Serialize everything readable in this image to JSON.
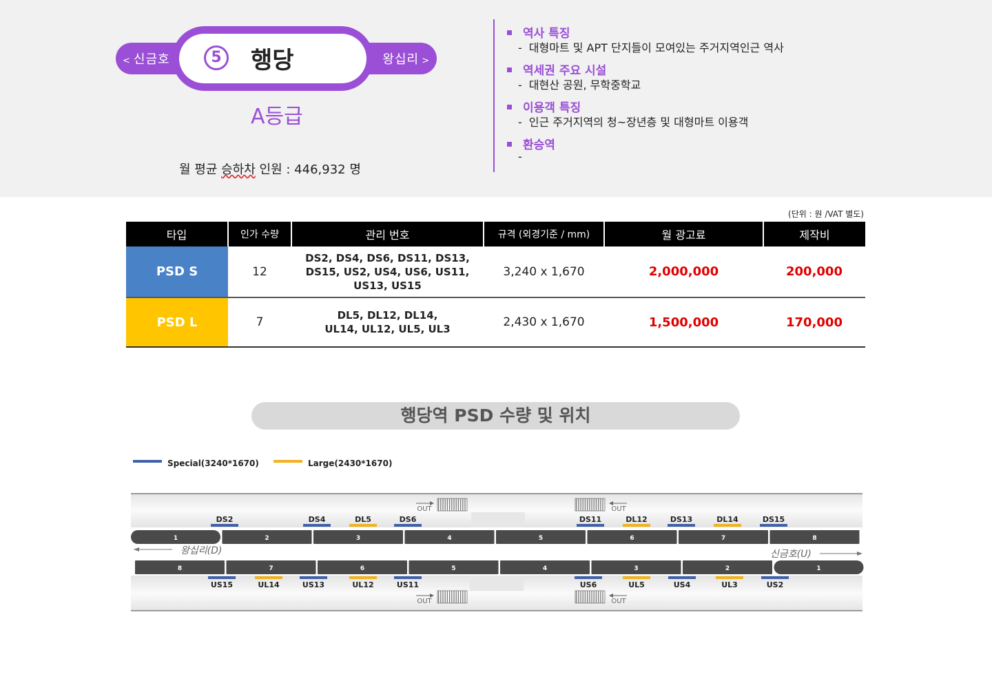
{
  "station": {
    "prev": "신금호",
    "next": "왕십리",
    "number": "5",
    "name": "행당",
    "grade": "A등급",
    "riders_label_a": "월 평균 ",
    "riders_label_u": "승하차",
    "riders_label_b": " 인원 : ",
    "riders_value": "446,932 명"
  },
  "facts": [
    {
      "heading": "역사 특징",
      "body": "대형마트 및 APT 단지들이 모여있는 주거지역인근 역사"
    },
    {
      "heading": "역세권 주요 시설",
      "body": "대현산 공원, 무학중학교"
    },
    {
      "heading": "이용객 특징",
      "body": "인근 주거지역의 청~장년층 및 대형마트 이용객"
    },
    {
      "heading": "환승역",
      "body": ""
    }
  ],
  "unit_note": "(단위 : 원 /VAT 별도)",
  "table": {
    "headers": [
      "타입",
      "인가 수량",
      "관리 번호",
      "규격 (외경기준 / mm)",
      "월 광고료",
      "제작비"
    ],
    "rows": [
      {
        "type": "PSD S",
        "qty": "12",
        "codes": [
          "DS2, DS4, DS6, DS11, DS13,",
          "DS15, US2, US4, US6, US11,",
          "US13, US15"
        ],
        "size": "3,240 x 1,670",
        "fee": "2,000,000",
        "cost": "200,000"
      },
      {
        "type": "PSD L",
        "qty": "7",
        "codes": [
          "DL5, DL12, DL14,",
          "UL14, UL12, UL5, UL3"
        ],
        "size": "2,430 x 1,670",
        "fee": "1,500,000",
        "cost": "170,000"
      }
    ]
  },
  "section_title": "행당역 PSD 수량 및 위치",
  "legend": [
    {
      "label": "Special(3240*1670)",
      "color": "#3f5fa8"
    },
    {
      "label": "Large(2430*1670)",
      "color": "#f2b21b"
    }
  ],
  "diagram": {
    "out_label": "OUT",
    "dir_left": "왕십리(D)",
    "dir_right": "신금호(U)",
    "upper_cars": [
      "1",
      "2",
      "3",
      "4",
      "5",
      "6",
      "7",
      "8"
    ],
    "lower_cars": [
      "8",
      "7",
      "6",
      "5",
      "4",
      "3",
      "2",
      "1"
    ],
    "upper_doors": [
      {
        "label": "DS2",
        "kind": "S"
      },
      {
        "label": "DS4",
        "kind": "S"
      },
      {
        "label": "DL5",
        "kind": "L"
      },
      {
        "label": "DS6",
        "kind": "S"
      },
      {
        "label": "DS11",
        "kind": "S"
      },
      {
        "label": "DL12",
        "kind": "L"
      },
      {
        "label": "DS13",
        "kind": "S"
      },
      {
        "label": "DL14",
        "kind": "L"
      },
      {
        "label": "DS15",
        "kind": "S"
      }
    ],
    "lower_doors": [
      {
        "label": "US15",
        "kind": "S"
      },
      {
        "label": "UL14",
        "kind": "L"
      },
      {
        "label": "US13",
        "kind": "S"
      },
      {
        "label": "UL12",
        "kind": "L"
      },
      {
        "label": "US11",
        "kind": "S"
      },
      {
        "label": "US6",
        "kind": "S"
      },
      {
        "label": "UL5",
        "kind": "L"
      },
      {
        "label": "US4",
        "kind": "S"
      },
      {
        "label": "UL3",
        "kind": "L"
      },
      {
        "label": "US2",
        "kind": "S"
      }
    ]
  }
}
